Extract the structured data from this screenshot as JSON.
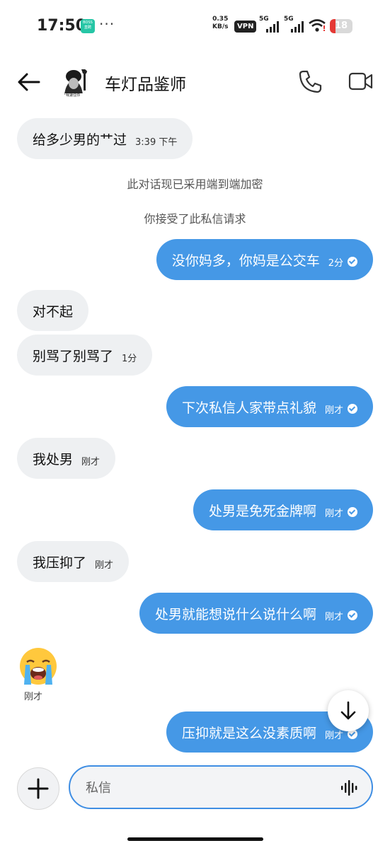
{
  "status_bar": {
    "time": "17:50",
    "boss_badge_top": "BOSS",
    "boss_badge_bottom": "直聘",
    "dots": "···",
    "speed_value": "0.35",
    "speed_unit": "KB/s",
    "vpn": "VPN",
    "net1": "5G",
    "net2": "5G",
    "battery": "18"
  },
  "header": {
    "title": "车灯品鉴师",
    "avatar_caption": "让我速住你"
  },
  "messages": [
    {
      "text": "给多少男的艹过",
      "time": "3:39 下午"
    },
    {
      "system": "此对话现已采用端到端加密"
    },
    {
      "system": "你接受了此私信请求"
    },
    {
      "text": "没你妈多，你妈是公交车",
      "time": "2分"
    },
    {
      "text": "对不起"
    },
    {
      "text": "别骂了别骂了",
      "time": "1分"
    },
    {
      "text": "下次私信人家带点礼貌",
      "time": "刚才"
    },
    {
      "text": "我处男",
      "time": "刚才"
    },
    {
      "text": "处男是免死金牌啊",
      "time": "刚才"
    },
    {
      "text": "我压抑了",
      "time": "刚才"
    },
    {
      "text": "处男就能想说什么说什么啊",
      "time": "刚才"
    },
    {
      "emoji": "loudly-crying-face",
      "time": "刚才"
    },
    {
      "text": "压抑就是这么没素质啊",
      "time": "刚才"
    }
  ],
  "composer": {
    "placeholder": "私信"
  },
  "colors": {
    "outgoing": "#4598e6",
    "incoming": "#eef0f2",
    "accent": "#3f8ee3",
    "battery_low": "#e53935"
  }
}
